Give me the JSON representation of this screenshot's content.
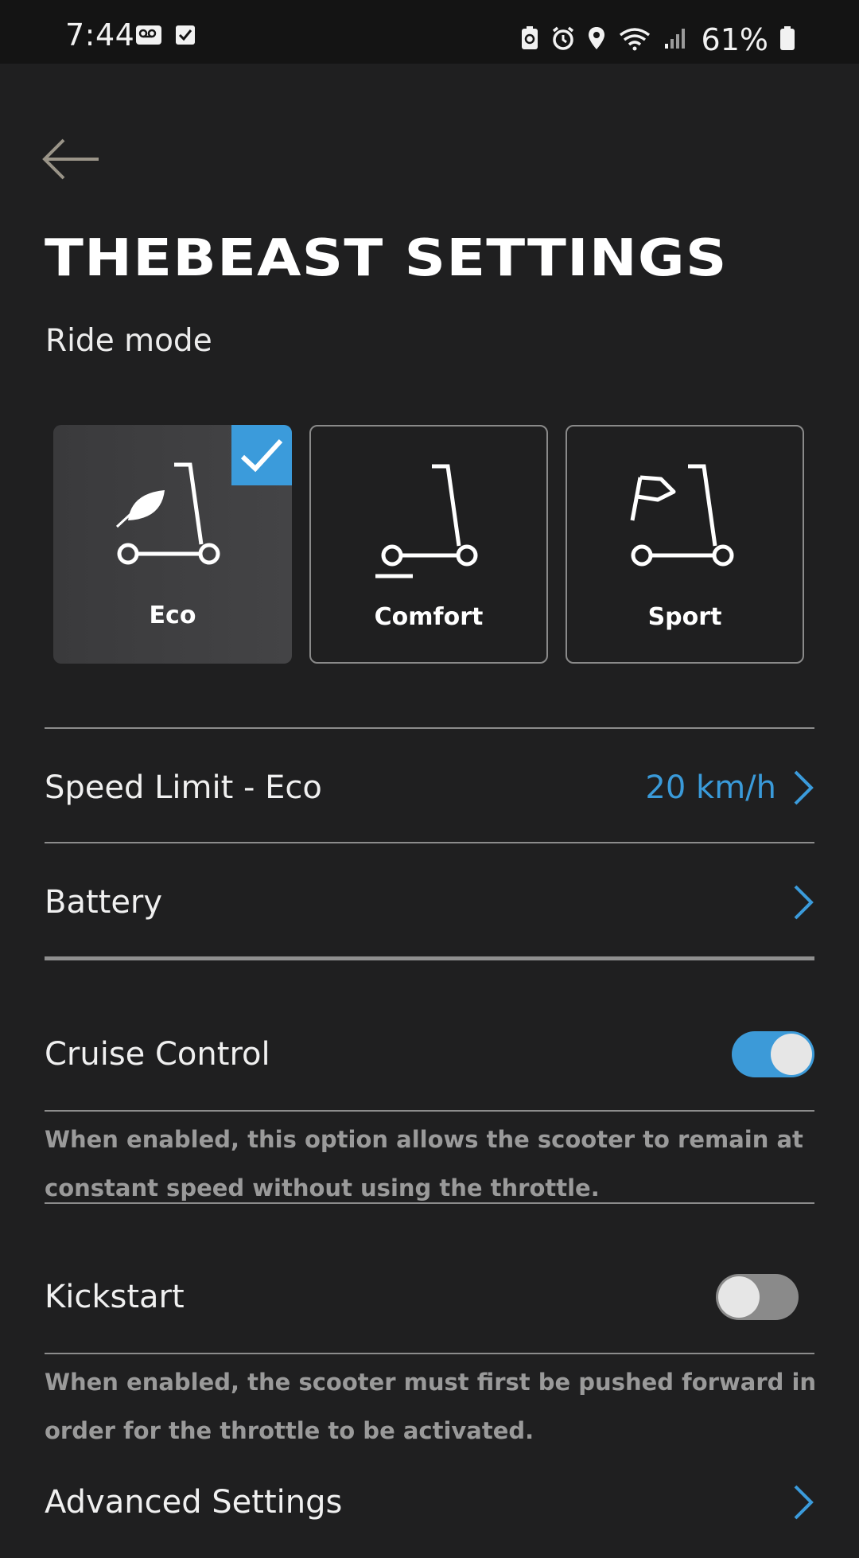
{
  "status_bar": {
    "time": "7:44",
    "battery_percent": "61%",
    "left_icons": [
      "voicemail-icon",
      "checkbox-icon"
    ],
    "right_icons": [
      "battery-saver-icon",
      "alarm-icon",
      "location-icon",
      "wifi-icon",
      "signal-icon",
      "battery-icon"
    ]
  },
  "header": {
    "back_icon": "back-arrow-icon",
    "title": "THEBEAST SETTINGS"
  },
  "ride_mode": {
    "label": "Ride mode",
    "selected": "Eco",
    "modes": [
      {
        "label": "Eco",
        "icon": "scooter-leaf-icon",
        "selected": true
      },
      {
        "label": "Comfort",
        "icon": "scooter-icon",
        "selected": false
      },
      {
        "label": "Sport",
        "icon": "scooter-flag-icon",
        "selected": false
      }
    ]
  },
  "speed_limit": {
    "label": "Speed Limit - Eco",
    "value": "20 km/h"
  },
  "battery": {
    "label": "Battery"
  },
  "cruise_control": {
    "label": "Cruise Control",
    "enabled": true,
    "description": "When enabled, this option allows the scooter to remain at constant speed without using the throttle."
  },
  "kickstart": {
    "label": "Kickstart",
    "enabled": false,
    "description": "When enabled, the scooter must first be pushed forward in order for the throttle to be activated."
  },
  "advanced_settings": {
    "label": "Advanced Settings"
  },
  "colors": {
    "background": "#1f1f20",
    "accent": "#3b9bdb",
    "divider": "#8c8c8c",
    "description_text": "#9a9a9a"
  }
}
